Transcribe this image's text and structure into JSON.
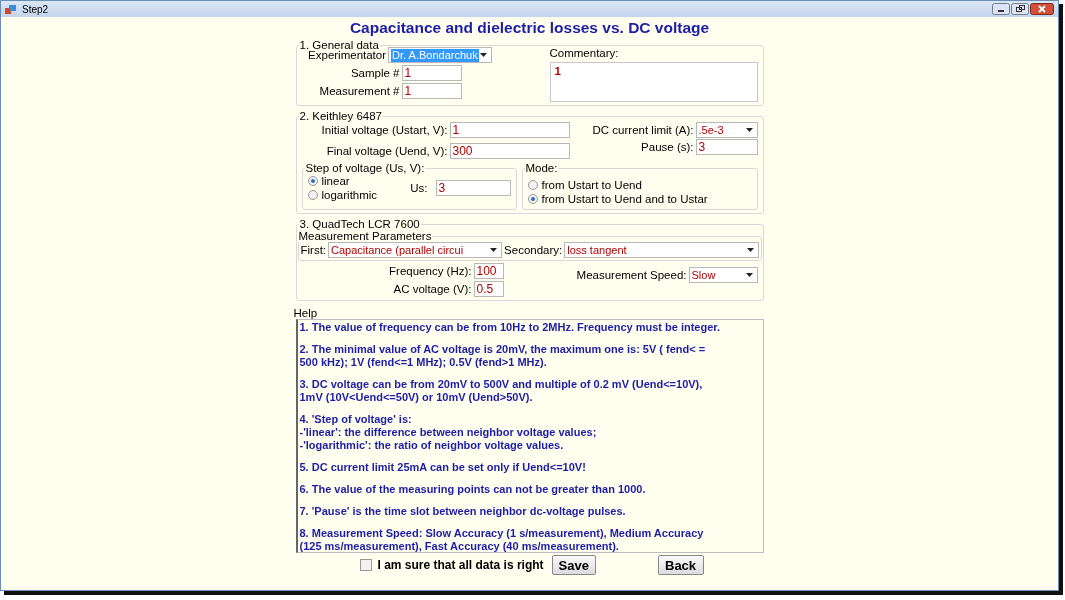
{
  "window": {
    "title": "Step2"
  },
  "heading": "Capacitance and dielectric losses vs. DC voltage",
  "general": {
    "legend": "1. General data",
    "fields": [
      {
        "label": "Experimentator",
        "kind": "combo",
        "value": "Dr. A.Bondarchuk",
        "highlighted": true
      },
      {
        "label": "Sample #",
        "kind": "text",
        "value": "1"
      },
      {
        "label": "Measurement #",
        "kind": "text",
        "value": "1"
      }
    ],
    "commentary": {
      "label": "Commentary:",
      "value": "1"
    }
  },
  "keithley": {
    "legend": "2. Keithley 6487",
    "left_fields": [
      {
        "label": "Initial voltage (Ustart, V):",
        "kind": "text",
        "value": "1"
      },
      {
        "label": "Final  voltage (Uend, V):",
        "kind": "text",
        "value": "300"
      }
    ],
    "right_fields": [
      {
        "label": "DC current limit (A):",
        "kind": "combo",
        "value": ".5e-3"
      },
      {
        "label": "Pause (s):",
        "kind": "text",
        "value": "3"
      }
    ],
    "step": {
      "legend": "Step of voltage (Us, V):",
      "options": [
        {
          "label": "linear",
          "selected": true
        },
        {
          "label": "logarithmic",
          "selected": false
        }
      ],
      "us": {
        "label": "Us:",
        "value": "3"
      }
    },
    "mode": {
      "legend": "Mode:",
      "options": [
        {
          "label": "from Ustart to Uend",
          "selected": false
        },
        {
          "label": "from Ustart to Uend and to Ustar",
          "selected": true
        }
      ]
    }
  },
  "quadtech": {
    "legend": "3. QuadTech LCR 7600",
    "params": {
      "legend": "Measurement Parameters",
      "first": {
        "label": "First:",
        "value": "Capacitance (parallel circui"
      },
      "secondary": {
        "label": "Secondary:",
        "value": "loss tangent"
      }
    },
    "fields": [
      {
        "label": "Frequency (Hz):",
        "value": "100"
      },
      {
        "label": "AC voltage (V):",
        "value": "0.5"
      }
    ],
    "speed": {
      "label": "Measurement Speed:",
      "value": "Slow"
    }
  },
  "help": {
    "legend": "Help",
    "paragraphs": [
      {
        "lines": [
          "1. The value of frequency can be from 10Hz to 2MHz. Frequency must be integer."
        ]
      },
      {
        "lines": [
          "2. The minimal value of AC voltage is 20mV, the maximum one is:  5V ( fend< =",
          "500 kHz); 1V (fend<=1 MHz); 0.5V (fend>1 MHz)."
        ]
      },
      {
        "lines": [
          "3. DC voltage can be from 20mV to 500V and multiple of 0.2 mV (Uend<=10V),",
          "1mV (10V<Uend<=50V) or 10mV (Uend>50V)."
        ]
      },
      {
        "lines": [
          "4. 'Step of voltage' is:",
          " -'linear': the difference between neighbor voltage values;",
          " -'logarithmic': the ratio of neighbor voltage values."
        ]
      },
      {
        "lines": [
          "5. DC current limit 25mA can be set only if Uend<=10V!"
        ]
      },
      {
        "lines": [
          "6. The value of the measuring points can not be greater than 1000."
        ]
      },
      {
        "lines": [
          "7. 'Pause' is the time slot between neighbor dc-voltage pulses."
        ]
      },
      {
        "lines": [
          "8. Measurement Speed: Slow Accuracy (1 s/measurement), Medium Accuracy",
          "(125 ms/measurement), Fast Accuracy (40 ms/measurement)."
        ]
      }
    ]
  },
  "confirm": {
    "label": "I am sure that all data is right",
    "checked": false
  },
  "buttons": [
    "Save",
    "Back"
  ]
}
